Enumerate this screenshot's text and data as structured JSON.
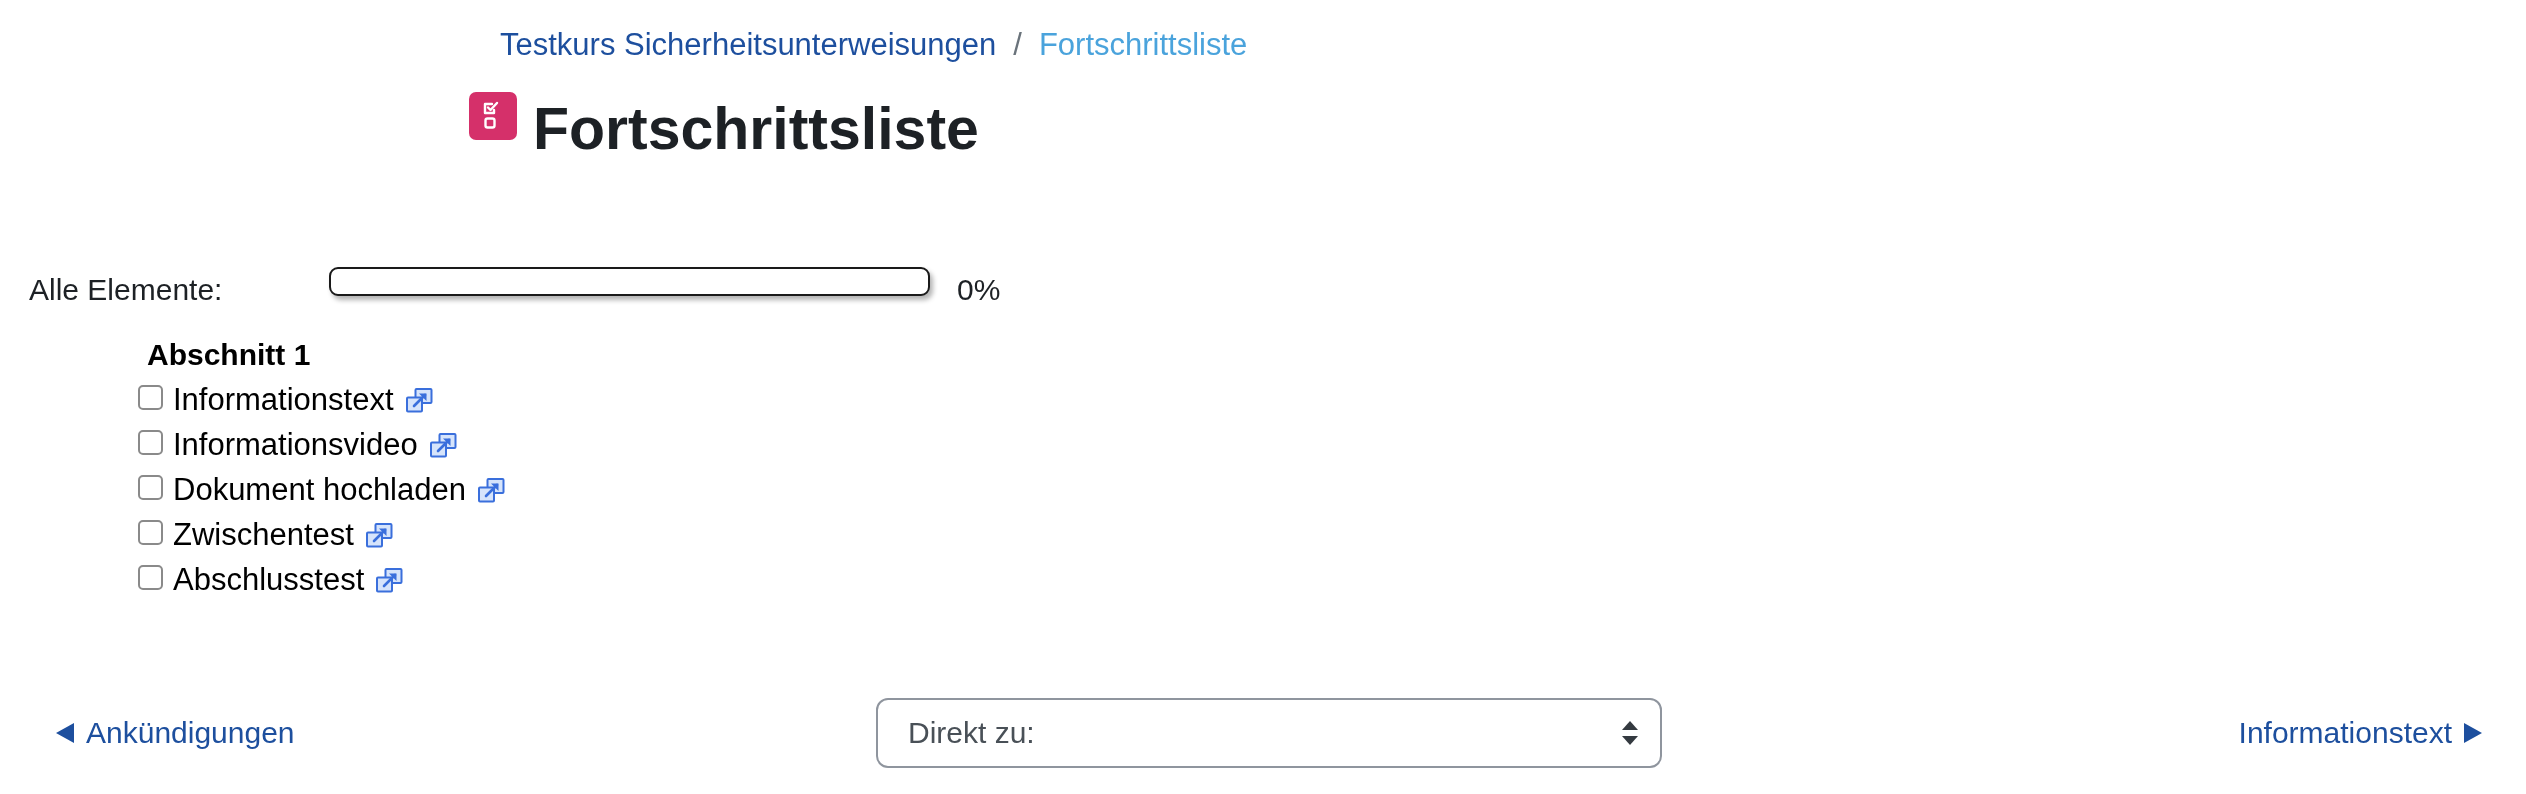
{
  "breadcrumb": {
    "items": [
      {
        "label": "Testkurs Sicherheitsunterweisungen",
        "current": false
      },
      {
        "label": "Fortschrittsliste",
        "current": true
      }
    ],
    "separator": "/"
  },
  "page": {
    "title": "Fortschrittsliste"
  },
  "progress": {
    "label": "Alle Elemente:",
    "level": 0,
    "reading": "0%"
  },
  "sections": [
    {
      "title": "Abschnitt 1",
      "items": [
        {
          "label": "Informationstext",
          "checked": false
        },
        {
          "label": "Informationsvideo",
          "checked": false
        },
        {
          "label": "Dokument hochladen",
          "checked": false
        },
        {
          "label": "Zwischentest",
          "checked": false
        },
        {
          "label": "Abschlusstest",
          "checked": false
        }
      ]
    }
  ],
  "navigation": {
    "previous": {
      "label": "Ankündigungen"
    },
    "jump_menu": {
      "value": "Direkt zu:"
    },
    "next": {
      "label": "Informationstext"
    }
  }
}
